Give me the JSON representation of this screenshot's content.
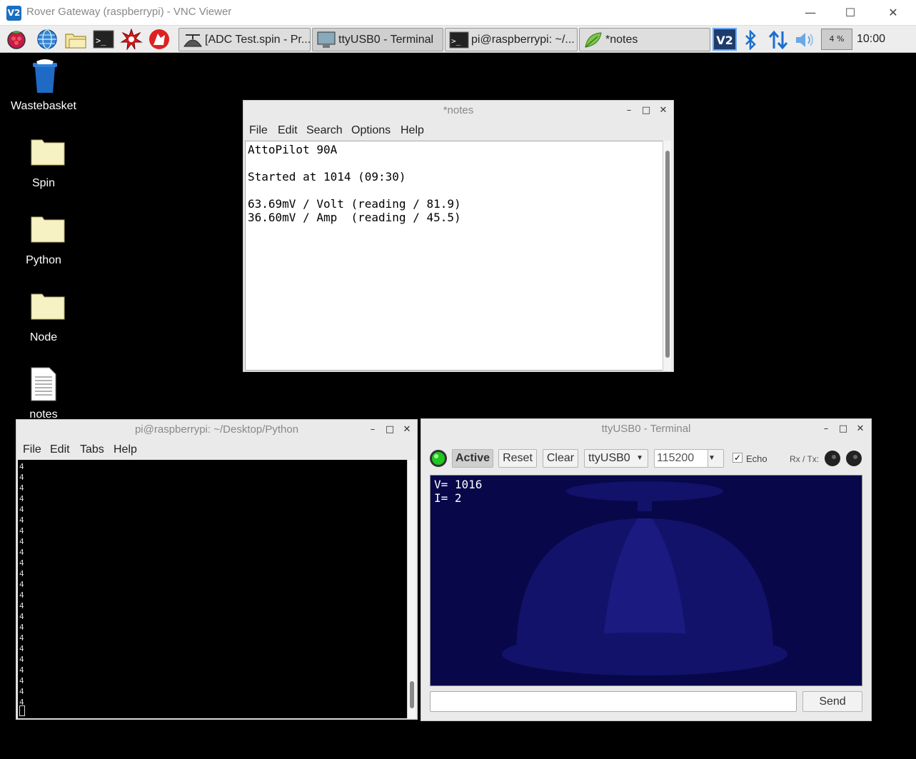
{
  "vnc": {
    "logo": "V2",
    "title": "Rover Gateway (raspberrypi) - VNC Viewer",
    "minimize": "—",
    "maximize": "☐",
    "close": "✕"
  },
  "taskbar": {
    "launchers": [
      "raspberry-icon",
      "globe-icon",
      "file-manager-icon",
      "terminal-icon",
      "burst-icon",
      "wolfram-icon"
    ],
    "tasks": [
      {
        "label": "[ADC Test.spin - Pr...",
        "icon": "propeller-icon"
      },
      {
        "label": "ttyUSB0 - Terminal",
        "icon": "monitor-icon"
      },
      {
        "label": "pi@raspberrypi: ~/...",
        "icon": "terminal-icon"
      },
      {
        "label": "*notes",
        "icon": "leaf-editor-icon"
      }
    ],
    "tray_vnc": "V2",
    "cpu": "4 %",
    "clock": "10:00"
  },
  "desktop": {
    "icons": [
      {
        "label": "Wastebasket",
        "icon": "trash-icon"
      },
      {
        "label": "Spin",
        "icon": "folder-icon"
      },
      {
        "label": "Python",
        "icon": "folder-icon"
      },
      {
        "label": "Node",
        "icon": "folder-icon"
      },
      {
        "label": "notes",
        "icon": "text-file-icon"
      }
    ]
  },
  "notes_window": {
    "title": "*notes",
    "menu": [
      "File",
      "Edit",
      "Search",
      "Options",
      "Help"
    ],
    "content": "AttoPilot 90A\n\nStarted at 1014 (09:30)\n\n63.69mV / Volt (reading / 81.9)\n36.60mV / Amp  (reading / 45.5)"
  },
  "python_window": {
    "title": "pi@raspberrypi: ~/Desktop/Python",
    "menu": [
      "File",
      "Edit",
      "Tabs",
      "Help"
    ],
    "output": "4\n4\n4\n4\n4\n4\n4\n4\n4\n4\n4\n4\n4\n4\n4\n4\n4\n4\n4\n4\n4\n4\n4"
  },
  "tty_window": {
    "title": "ttyUSB0 - Terminal",
    "active_label": "Active",
    "reset_label": "Reset",
    "clear_label": "Clear",
    "port": "ttyUSB0",
    "baud": "115200",
    "echo_label": "Echo",
    "rxtx_label": "Rx / Tx:",
    "output": "V= 1016\nI= 2",
    "send_label": "Send"
  },
  "colors": {
    "tty_bg": "#07074a",
    "active_led": "#1ec81e"
  }
}
